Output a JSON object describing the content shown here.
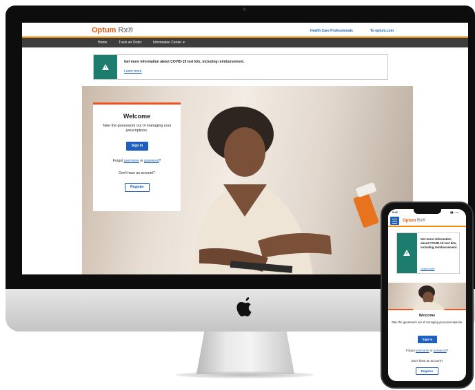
{
  "site": {
    "logo_brand": "Optum",
    "logo_suffix": "Rx®",
    "header_links": [
      "Health Care Professionals",
      "To optum.com"
    ]
  },
  "nav": {
    "items": [
      "Home",
      "Track an Order",
      "Information Center"
    ]
  },
  "alert": {
    "icon": "warning-triangle-icon",
    "message": "Get more information about COVID-19 test kits, including reimbursement.",
    "link_label": "Learn more"
  },
  "welcome": {
    "title": "Welcome",
    "subtitle": "Take the guesswork out of managing your prescriptions.",
    "signin_label": "Sign in",
    "forgot_prefix": "Forgot ",
    "username_link": "username",
    "forgot_or": " or ",
    "password_link": "password",
    "forgot_suffix": "?",
    "no_account": "Don't have an account?",
    "register_label": "Register"
  },
  "phone": {
    "time": "9:41",
    "alert_message": "Get more information about COVID-19 test kits, including reimbursement.",
    "alert_link": "Learn more",
    "title": "Welcome",
    "subtitle": "Take the guesswork out of managing your prescriptions.",
    "signin_label": "Sign in",
    "no_account": "Don't have an account?",
    "register_label": "Register"
  },
  "colors": {
    "brand_orange": "#e05a0c",
    "accent_teal": "#1c7d6f",
    "button_blue": "#1f5fbf",
    "nav_dark": "#3d3d3d"
  }
}
